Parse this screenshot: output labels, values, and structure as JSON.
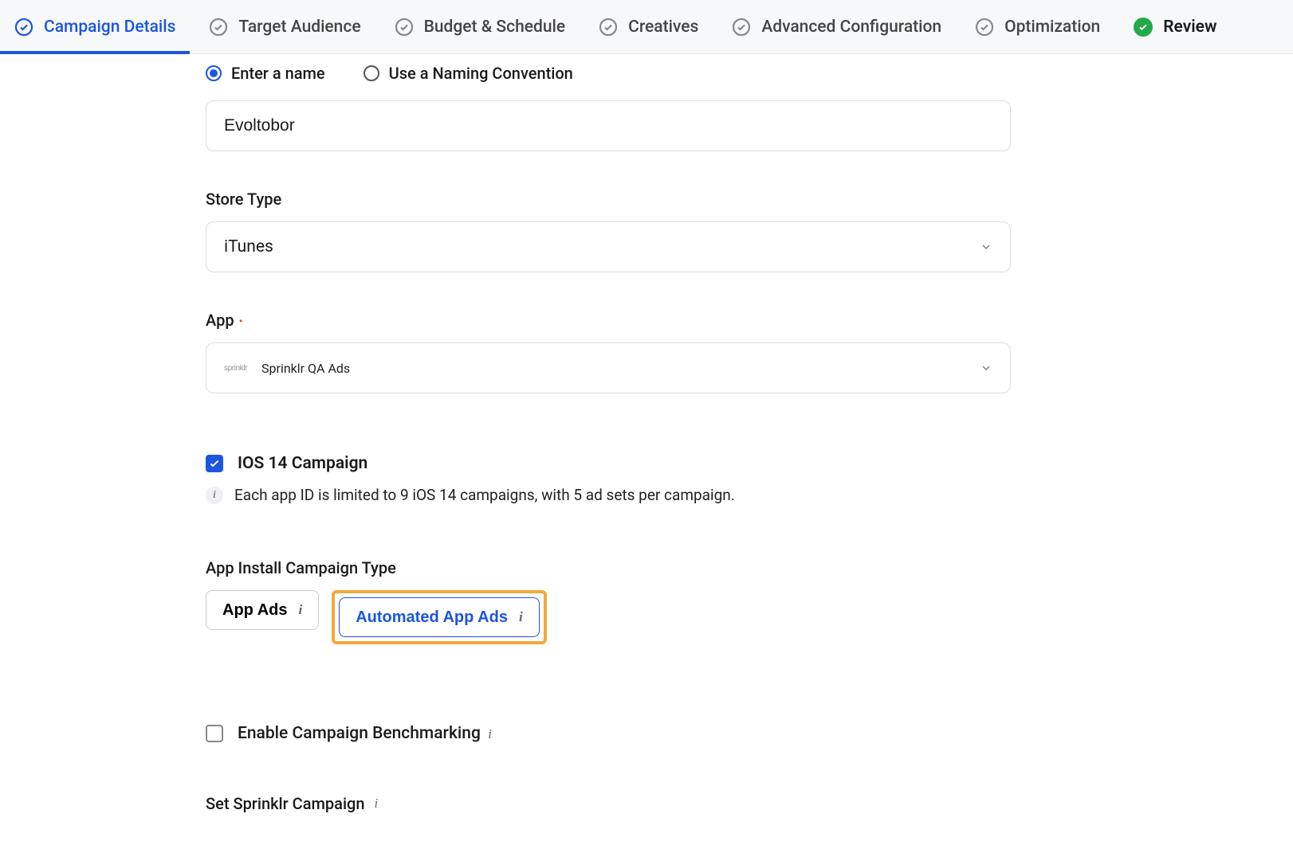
{
  "tabs": [
    {
      "label": "Campaign Details",
      "state": "active"
    },
    {
      "label": "Target Audience",
      "state": "pending"
    },
    {
      "label": "Budget & Schedule",
      "state": "pending"
    },
    {
      "label": "Creatives",
      "state": "pending"
    },
    {
      "label": "Advanced Configuration",
      "state": "pending"
    },
    {
      "label": "Optimization",
      "state": "pending"
    },
    {
      "label": "Review",
      "state": "completed"
    }
  ],
  "name_mode": {
    "enter_label": "Enter a name",
    "convention_label": "Use a Naming Convention"
  },
  "campaign_name": "Evoltobor",
  "store_type": {
    "label": "Store Type",
    "value": "iTunes"
  },
  "app": {
    "label": "App",
    "logo_text": "sprinklr",
    "value": "Sprinklr QA Ads"
  },
  "ios14": {
    "label": "IOS 14 Campaign",
    "info": "Each app ID is limited to 9 iOS 14 campaigns, with 5 ad sets per campaign."
  },
  "install_type": {
    "label": "App Install Campaign Type",
    "options": [
      {
        "label": "App Ads"
      },
      {
        "label": "Automated App Ads",
        "selected": true
      }
    ]
  },
  "benchmarking": {
    "label": "Enable Campaign Benchmarking"
  },
  "set_sprinklr": {
    "label": "Set Sprinklr Campaign"
  }
}
